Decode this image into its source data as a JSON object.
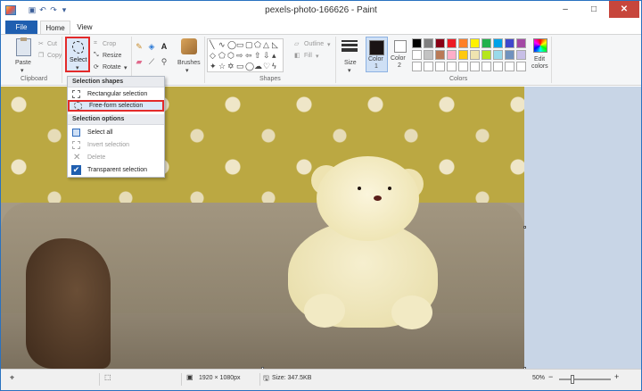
{
  "window": {
    "title": "pexels-photo-166626 - Paint",
    "controls": {
      "minimize": "–",
      "maximize": "□",
      "close": "✕"
    }
  },
  "quick_access": [
    {
      "icon": "save-icon",
      "glyph": "▣"
    },
    {
      "icon": "undo-icon",
      "glyph": "↶"
    },
    {
      "icon": "redo-icon",
      "glyph": "↷"
    },
    {
      "icon": "customize-icon",
      "glyph": "▾"
    }
  ],
  "tabs": {
    "file": "File",
    "home": "Home",
    "view": "View"
  },
  "ribbon": {
    "clipboard": {
      "label": "Clipboard",
      "paste": "Paste",
      "cut": "Cut",
      "copy": "Copy"
    },
    "image": {
      "select": "Select",
      "crop": "Crop",
      "resize": "Resize",
      "rotate": "Rotate"
    },
    "tools": {
      "text_glyph": "A"
    },
    "brushes": "Brushes",
    "shapes": {
      "label": "Shapes",
      "outline": "Outline",
      "fill": "Fill"
    },
    "size": "Size",
    "colors": {
      "label": "Colors",
      "color1": "Color",
      "color1_num": "1",
      "color2": "Color",
      "color2_num": "2",
      "edit": "Edit",
      "edit2": "colors",
      "color1_value": "#1a1414",
      "color2_value": "#ffffff",
      "palette_row1": [
        "#000000",
        "#7f7f7f",
        "#880015",
        "#ed1c24",
        "#ff7f27",
        "#fff200",
        "#22b14c",
        "#00a2e8",
        "#3f48cc",
        "#a349a4"
      ],
      "palette_row2": [
        "#ffffff",
        "#c3c3c3",
        "#b97a57",
        "#ffaec9",
        "#ffc90e",
        "#efe4b0",
        "#b5e61d",
        "#99d9ea",
        "#7092be",
        "#c8bfe7"
      ]
    }
  },
  "menu": {
    "shapes_header": "Selection shapes",
    "rectangular": "Rectangular selection",
    "freeform": "Free-form selection",
    "options_header": "Selection options",
    "select_all": "Select all",
    "invert": "Invert selection",
    "delete": "Delete",
    "transparent": "Transparent selection"
  },
  "status": {
    "dimensions": "1920 × 1080px",
    "size": "Size: 347.5KB",
    "zoom": "50%",
    "zoom_minus": "−",
    "zoom_plus": "+"
  }
}
